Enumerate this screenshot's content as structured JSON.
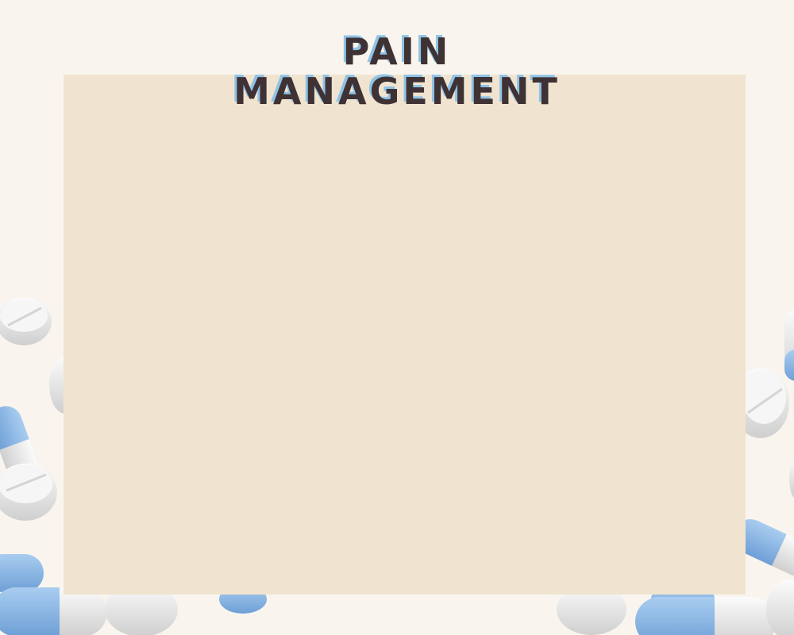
{
  "title": {
    "line1": "PAIN",
    "line2": "MANAGEMENT"
  },
  "colors": {
    "background": "#f9f5ee",
    "panel": "#f0e4d0",
    "title_text": "#3f3234",
    "title_shadow": "#8fc3e6",
    "pill_white": "#e9e9e9",
    "capsule_blue": "#8fbbe6"
  },
  "decorations": {
    "left_cluster": "pills-and-capsules-icon",
    "right_cluster": "pills-and-capsules-icon"
  }
}
